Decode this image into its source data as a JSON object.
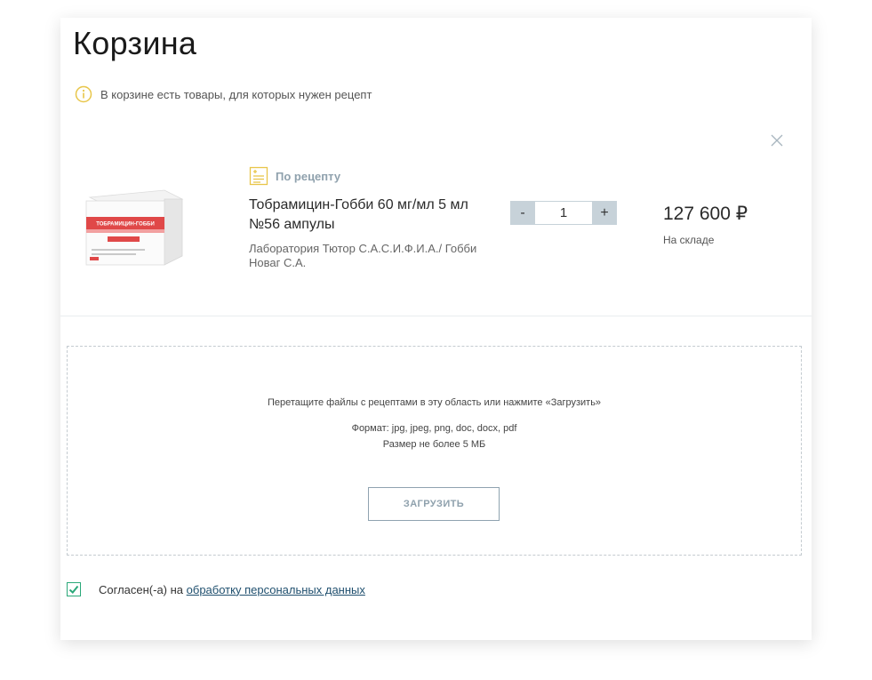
{
  "cart": {
    "title": "Корзина",
    "notice": "В корзине есть товары, для которых нужен рецепт"
  },
  "item": {
    "rx_label": "По рецепту",
    "name": "Тобрамицин-Гобби 60 мг/мл 5 мл №56 ампулы",
    "manufacturer": "Лаборатория Тютор С.А.С.И.Ф.И.А./ Гобби Новаг С.А.",
    "quantity": "1",
    "decrement_label": "-",
    "increment_label": "+",
    "price": "127 600 ₽",
    "stock": "На складе",
    "package_brand": "ТОБРАМИЦИН-ГОББИ"
  },
  "upload": {
    "instruction": "Перетащите файлы с рецептами в эту область или нажмите «Загрузить»",
    "formats": "Формат: jpg, jpeg, png, doc, docx, pdf",
    "size_limit": "Размер не более 5 МБ",
    "button_label": "ЗАГРУЗИТЬ"
  },
  "consent": {
    "text": "Согласен(-а) на ",
    "link": "обработку персональных данных",
    "checked": true
  },
  "colors": {
    "accent_gray": "#8fa1ad",
    "stepper_bg": "#c7d2d9",
    "check_green": "#2aa879",
    "info_yellow": "#e8c64a",
    "link_blue": "#1f4f6e"
  },
  "icons": {
    "notice": "info-icon",
    "close": "close-icon",
    "rx": "prescription-icon",
    "check": "checkmark-icon"
  }
}
